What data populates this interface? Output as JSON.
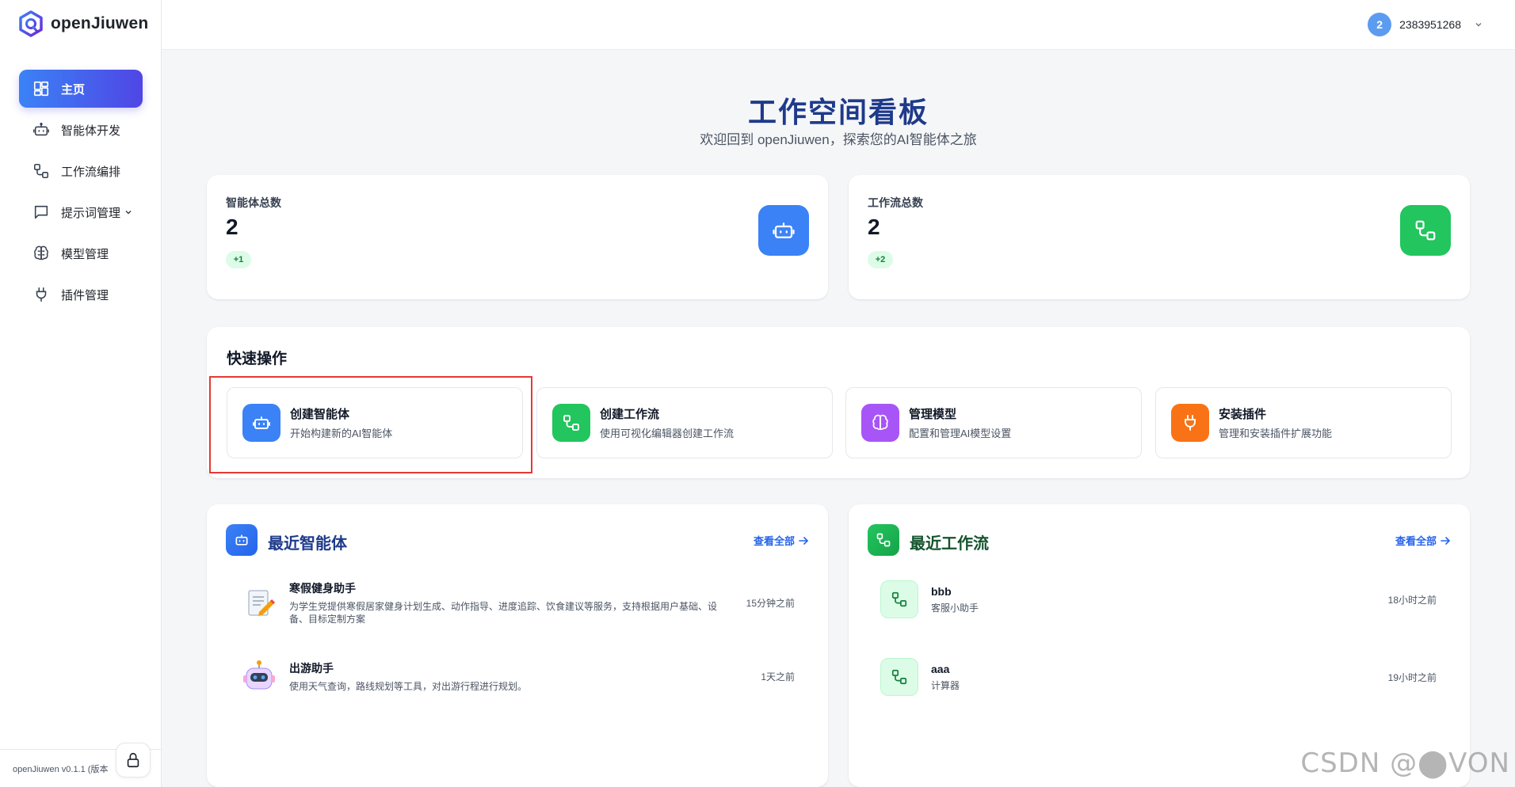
{
  "app": {
    "name": "openJiuwen",
    "version_text": "openJiuwen v0.1.1 (版本"
  },
  "colors": {
    "primary": "#3b82f6",
    "indigo": "#4f46e5",
    "green": "#22c55e",
    "purple": "#a855f7",
    "orange": "#f97316",
    "title": "#1e3a8a",
    "highlight": "#e53935"
  },
  "sidebar": {
    "items": [
      {
        "label": "主页",
        "icon": "dashboard-icon",
        "active": true
      },
      {
        "label": "智能体开发",
        "icon": "robot-icon"
      },
      {
        "label": "工作流编排",
        "icon": "workflow-icon"
      },
      {
        "label": "提示词管理",
        "icon": "chat-bubble-icon",
        "has_submenu": true
      },
      {
        "label": "模型管理",
        "icon": "brain-icon"
      },
      {
        "label": "插件管理",
        "icon": "plug-icon"
      }
    ]
  },
  "topbar": {
    "user_avatar": "2",
    "user_name": "2383951268"
  },
  "page": {
    "title": "工作空间看板",
    "subtitle": "欢迎回到 openJiuwen，探索您的AI智能体之旅"
  },
  "stats": [
    {
      "label": "智能体总数",
      "value": "2",
      "badge": "+1",
      "icon": "robot-icon",
      "color": "#3b82f6"
    },
    {
      "label": "工作流总数",
      "value": "2",
      "badge": "+2",
      "icon": "workflow-icon",
      "color": "#22c55e"
    }
  ],
  "quick_actions": {
    "title": "快速操作",
    "items": [
      {
        "title": "创建智能体",
        "desc": "开始构建新的AI智能体",
        "icon": "robot-icon",
        "color": "#3b82f6"
      },
      {
        "title": "创建工作流",
        "desc": "使用可视化编辑器创建工作流",
        "icon": "workflow-icon",
        "color": "#22c55e"
      },
      {
        "title": "管理模型",
        "desc": "配置和管理AI模型设置",
        "icon": "brain-icon",
        "color": "#a855f7"
      },
      {
        "title": "安装插件",
        "desc": "管理和安装插件扩展功能",
        "icon": "plug-icon",
        "color": "#f97316"
      }
    ]
  },
  "recent_agents": {
    "title": "最近智能体",
    "view_all": "查看全部",
    "items": [
      {
        "name": "寒假健身助手",
        "desc": "为学生党提供寒假居家健身计划生成、动作指导、进度追踪、饮食建议等服务，支持根据用户基础、设备、目标定制方案",
        "time": "15分钟之前",
        "avatar": "notepad-pencil-icon"
      },
      {
        "name": "出游助手",
        "desc": "使用天气查询，路线规划等工具，对出游行程进行规划。",
        "time": "1天之前",
        "avatar": "robot-face-icon"
      }
    ]
  },
  "recent_workflows": {
    "title": "最近工作流",
    "view_all": "查看全部",
    "items": [
      {
        "name": "bbb",
        "desc": "客服小助手",
        "time": "18小时之前"
      },
      {
        "name": "aaa",
        "desc": "计算器",
        "time": "19小时之前"
      }
    ]
  },
  "watermark": "CSDN @⬤VON"
}
